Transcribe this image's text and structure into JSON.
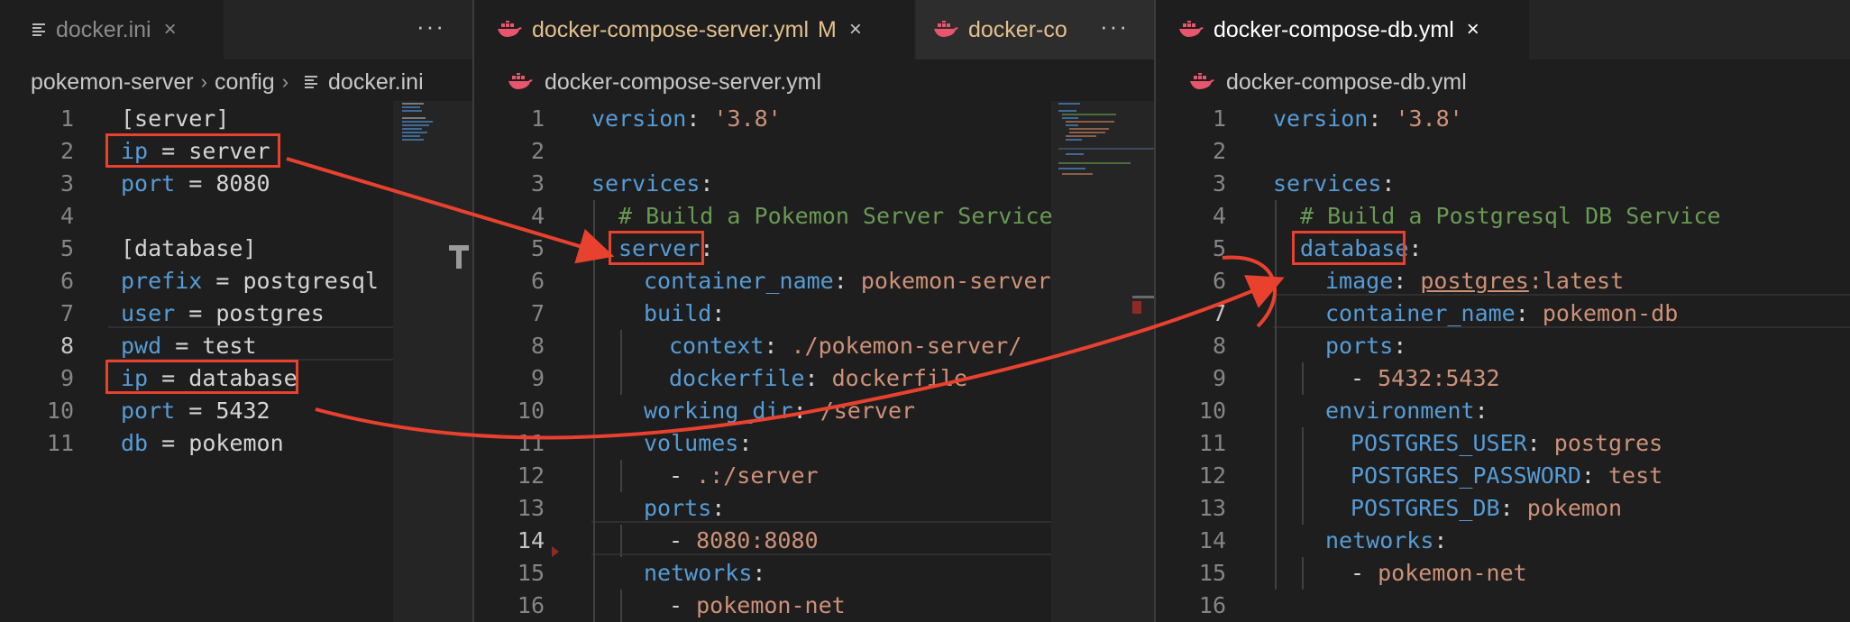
{
  "colors": {
    "keyword": "#569cd6",
    "string": "#ce9178",
    "comment": "#6a9955",
    "text": "#d4d4d4",
    "highlight_box": "#e8412e",
    "modified": "#e2c08d",
    "docker_icon": "#e8566c"
  },
  "left_pane": {
    "tab": {
      "icon": "lines-file-icon",
      "name": "docker.ini",
      "close": "×"
    },
    "more": "···",
    "breadcrumb": {
      "p1": "pokemon-server",
      "p2": "config",
      "p3": "docker.ini",
      "sep": "›"
    },
    "lines": [
      {
        "n": "1",
        "t": "[server]"
      },
      {
        "n": "2",
        "k": "ip",
        "r": " = server"
      },
      {
        "n": "3",
        "k": "port",
        "r": " = 8080"
      },
      {
        "n": "4",
        "t": ""
      },
      {
        "n": "5",
        "t": "[database]"
      },
      {
        "n": "6",
        "k": "prefix",
        "r": " = postgresql"
      },
      {
        "n": "7",
        "k": "user",
        "r": " = postgres"
      },
      {
        "n": "8",
        "k": "pwd",
        "r": " = test"
      },
      {
        "n": "9",
        "k": "ip",
        "r": " = database"
      },
      {
        "n": "10",
        "k": "port",
        "r": " = 5432"
      },
      {
        "n": "11",
        "k": "db",
        "r": " = pokemon"
      }
    ]
  },
  "middle_pane": {
    "tab1": {
      "icon": "docker-icon",
      "name": "docker-compose-server.yml",
      "mod": "M",
      "close": "×"
    },
    "tab2": {
      "icon": "docker-icon",
      "name": "docker-co"
    },
    "more": "···",
    "breadcrumb": {
      "icon": "docker-icon",
      "file": "docker-compose-server.yml"
    },
    "lines": {
      "l1": {
        "n": "1",
        "k": "version",
        "p": ": ",
        "s": "'3.8'"
      },
      "l2": {
        "n": "2"
      },
      "l3": {
        "n": "3",
        "k": "services",
        "p": ":"
      },
      "l4": {
        "n": "4",
        "c": "# Build a Pokemon Server Service"
      },
      "l5": {
        "n": "5",
        "k": "server",
        "p": ":"
      },
      "l6": {
        "n": "6",
        "k": "container_name",
        "p": ": ",
        "s": "pokemon-server"
      },
      "l7": {
        "n": "7",
        "k": "build",
        "p": ":"
      },
      "l8": {
        "n": "8",
        "k": "context",
        "p": ": ",
        "s": "./pokemon-server/"
      },
      "l9": {
        "n": "9",
        "k": "dockerfile",
        "p": ": ",
        "s": "dockerfile"
      },
      "l10": {
        "n": "10",
        "k": "working_dir",
        "p": ": ",
        "s": "/server"
      },
      "l11": {
        "n": "11",
        "k": "volumes",
        "p": ":"
      },
      "l12": {
        "n": "12",
        "d": "- ",
        "s": ".:/server"
      },
      "l13": {
        "n": "13",
        "k": "ports",
        "p": ":"
      },
      "l14": {
        "n": "14",
        "d": "- ",
        "s": "8080:8080"
      },
      "l15": {
        "n": "15",
        "k": "networks",
        "p": ":"
      },
      "l16": {
        "n": "16",
        "d": "- ",
        "s": "pokemon-net"
      }
    }
  },
  "right_pane": {
    "tab": {
      "icon": "docker-icon",
      "name": "docker-compose-db.yml",
      "close": "×"
    },
    "breadcrumb": {
      "icon": "docker-icon",
      "file": "docker-compose-db.yml"
    },
    "lines": {
      "l1": {
        "n": "1",
        "k": "version",
        "p": ": ",
        "s": "'3.8'"
      },
      "l2": {
        "n": "2"
      },
      "l3": {
        "n": "3",
        "k": "services",
        "p": ":"
      },
      "l4": {
        "n": "4",
        "c": "# Build a Postgresql DB Service"
      },
      "l5": {
        "n": "5",
        "k": "database",
        "p": ":"
      },
      "l6": {
        "n": "6",
        "k": "image",
        "p": ": ",
        "s1": "postgres",
        "s2": ":latest"
      },
      "l7": {
        "n": "7",
        "k": "container_name",
        "p": ": ",
        "s": "pokemon-db"
      },
      "l8": {
        "n": "8",
        "k": "ports",
        "p": ":"
      },
      "l9": {
        "n": "9",
        "d": "- ",
        "s": "5432:5432"
      },
      "l10": {
        "n": "10",
        "k": "environment",
        "p": ":"
      },
      "l11": {
        "n": "11",
        "k": "POSTGRES_USER",
        "p": ": ",
        "s": "postgres"
      },
      "l12": {
        "n": "12",
        "k": "POSTGRES_PASSWORD",
        "p": ": ",
        "s": "test"
      },
      "l13": {
        "n": "13",
        "k": "POSTGRES_DB",
        "p": ": ",
        "s": "pokemon"
      },
      "l14": {
        "n": "14",
        "k": "networks",
        "p": ":"
      },
      "l15": {
        "n": "15",
        "d": "- ",
        "s": "pokemon-net"
      },
      "l16": {
        "n": "16"
      }
    }
  }
}
